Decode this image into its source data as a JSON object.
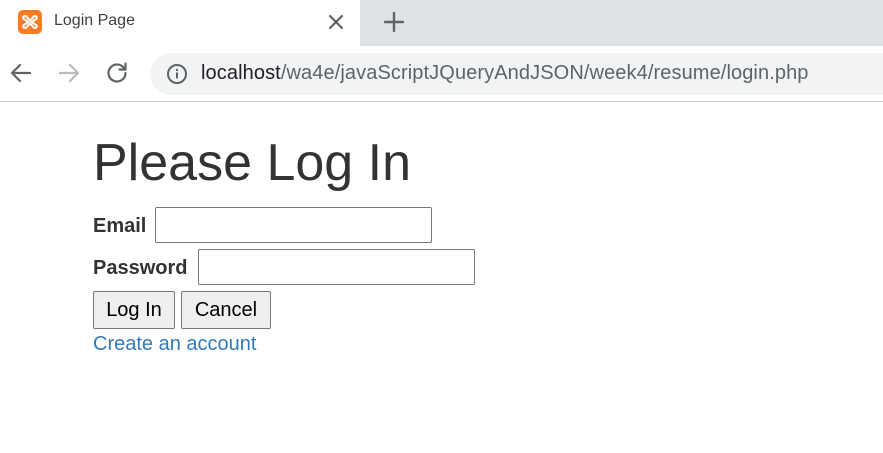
{
  "browser": {
    "tab": {
      "title": "Login Page",
      "favicon": "xampp-logo-icon"
    },
    "icons": {
      "tab_close": "close-icon",
      "new_tab": "plus-icon",
      "back": "arrow-left-icon",
      "forward": "arrow-right-icon",
      "reload": "reload-icon",
      "site_info": "info-icon"
    },
    "address_bar": {
      "host": "localhost",
      "path": "/wa4e/javaScriptJQueryAndJSON/week4/resume/login.php"
    },
    "colors": {
      "tabstrip": "#dee1e6",
      "omnibox": "#f1f3f4",
      "favicon": "#fb7a24"
    }
  },
  "page": {
    "title": "Please Log In",
    "form": {
      "email_label": "Email",
      "email_value": "",
      "password_label": "Password",
      "password_value": "",
      "login_button": "Log In",
      "cancel_button": "Cancel"
    },
    "create_account_link": "Create an account",
    "colors": {
      "text": "#333333",
      "link": "#337ab7"
    }
  }
}
